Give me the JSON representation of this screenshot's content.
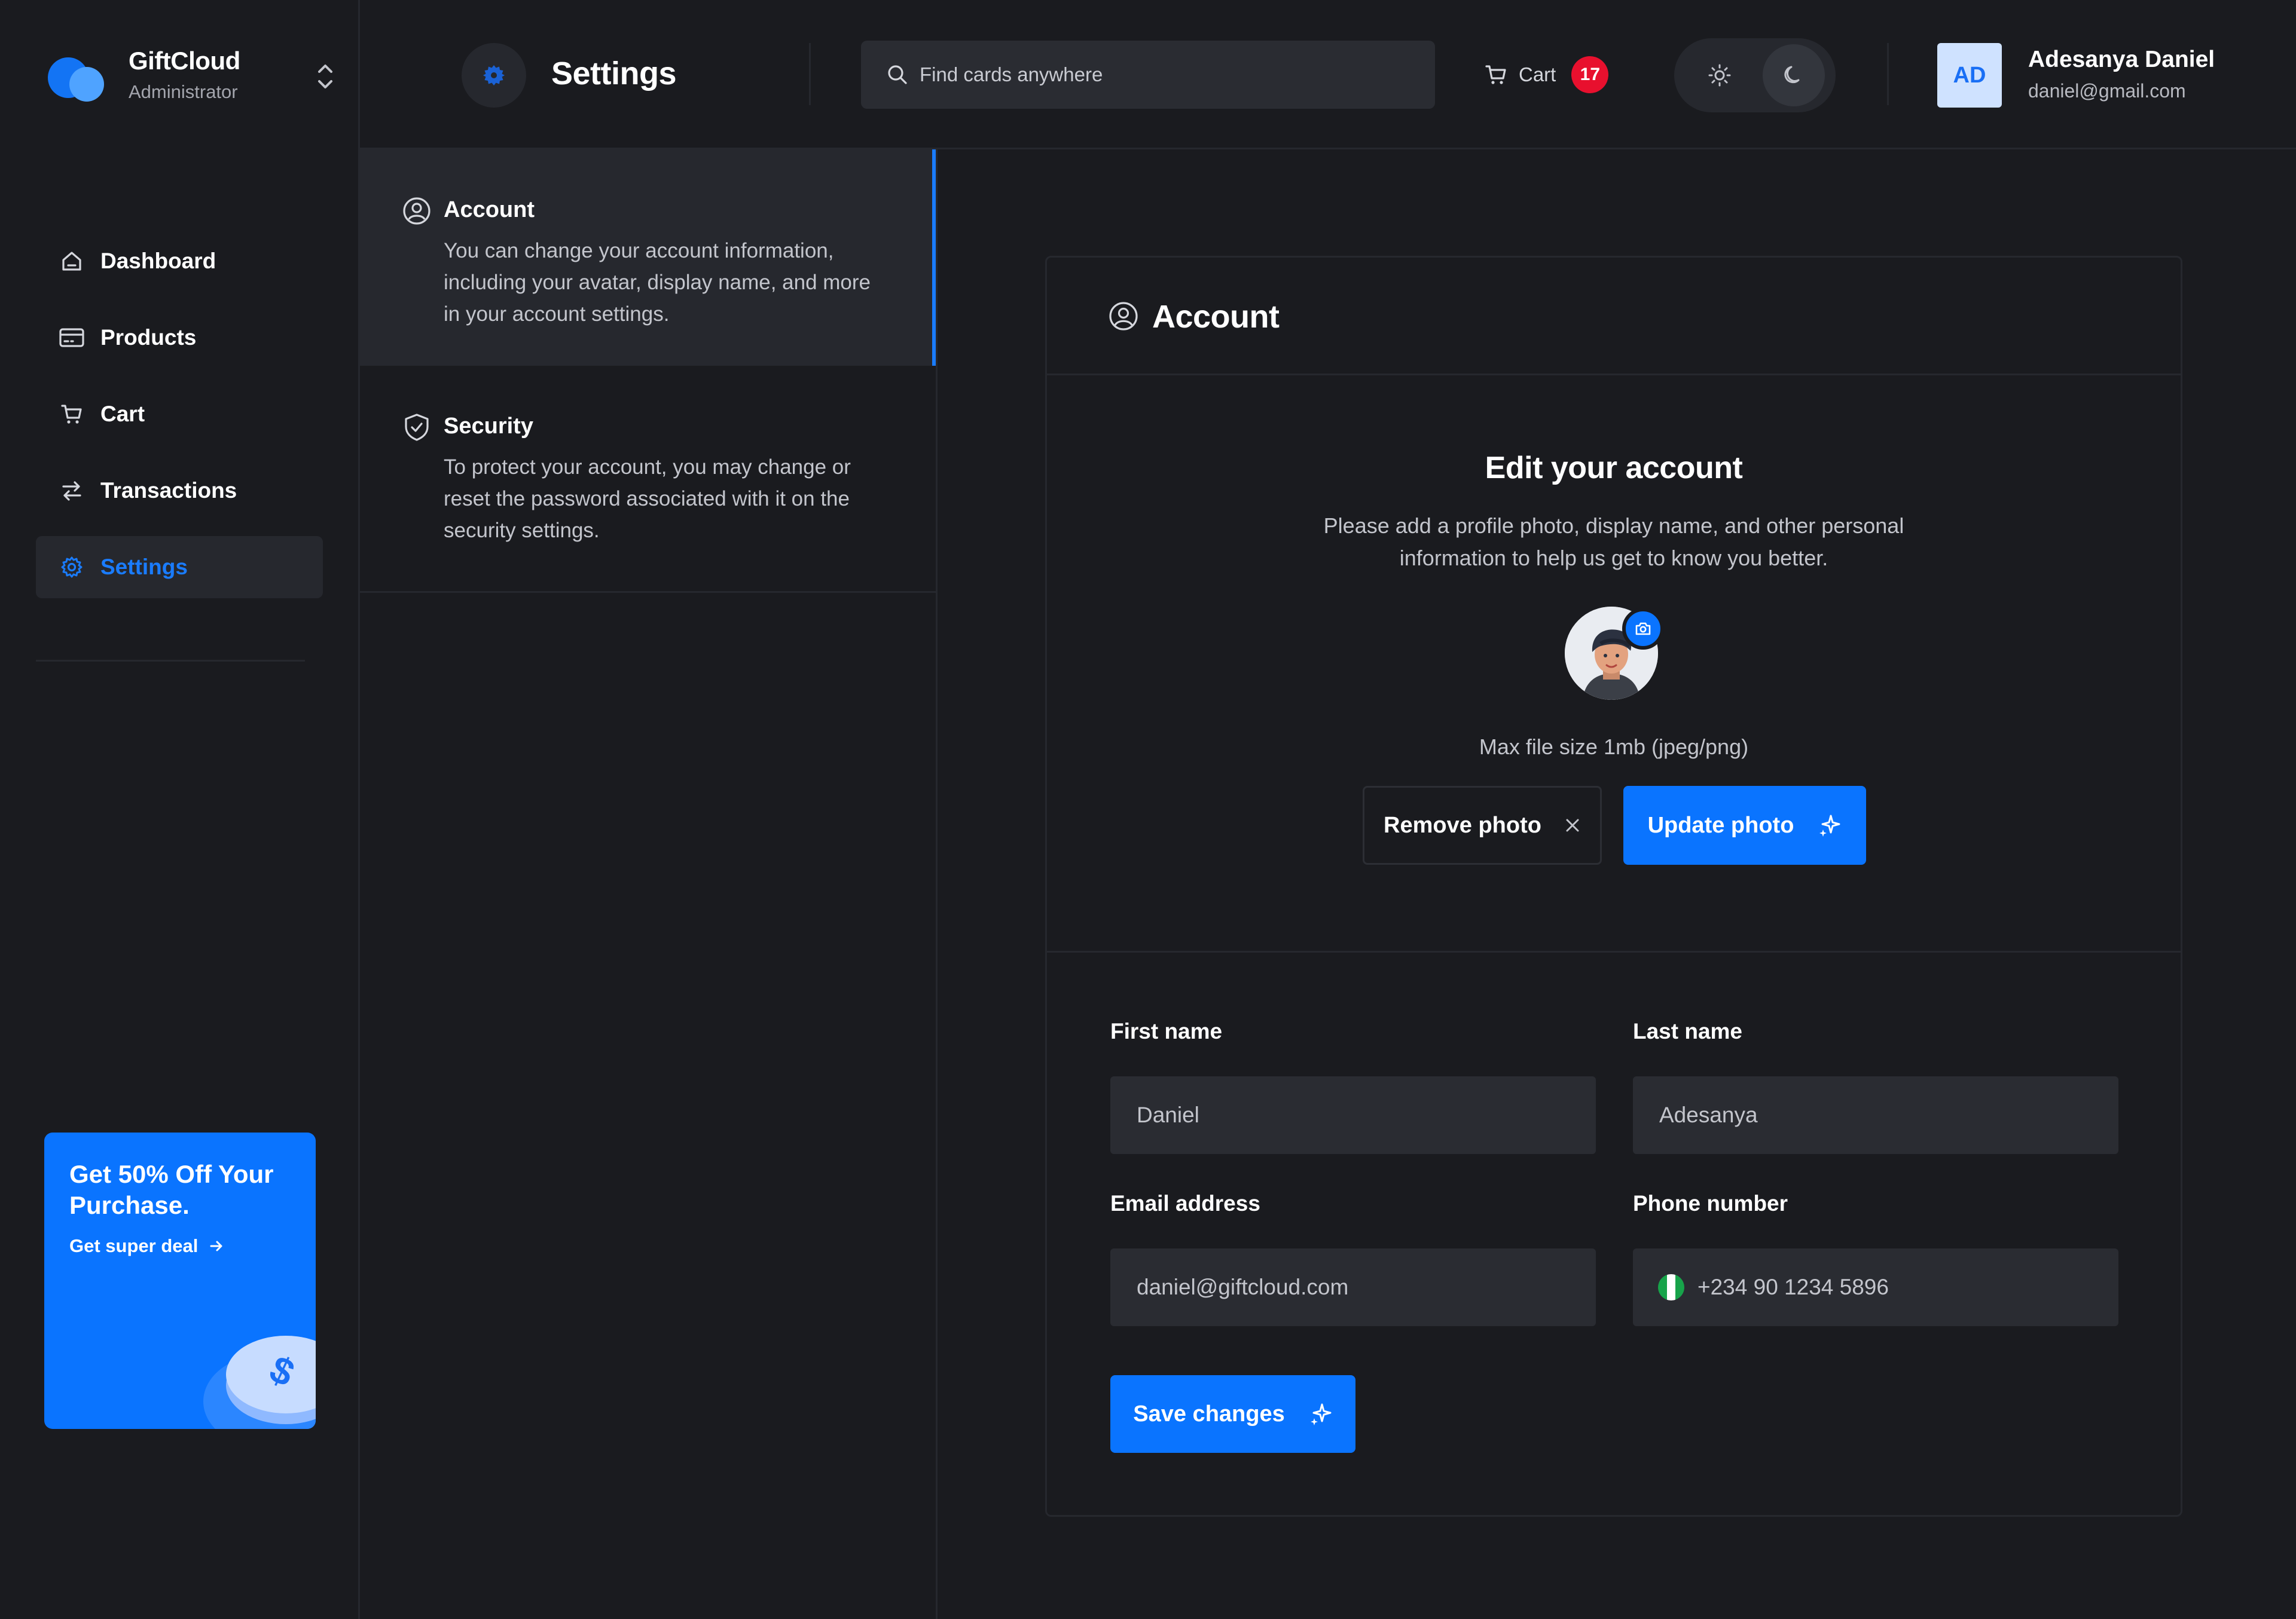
{
  "brand": {
    "name": "GiftCloud",
    "role": "Administrator",
    "colors": {
      "primary": "#1374f4",
      "secondary": "#4fa3ff"
    }
  },
  "sidebar": {
    "items": [
      {
        "label": "Dashboard",
        "icon": "home-icon"
      },
      {
        "label": "Products",
        "icon": "card-icon"
      },
      {
        "label": "Cart",
        "icon": "cart-icon"
      },
      {
        "label": "Transactions",
        "icon": "swap-arrows-icon"
      },
      {
        "label": "Settings",
        "icon": "gear-icon",
        "active": true
      }
    ]
  },
  "promo": {
    "title": "Get 50% Off Your Purchase.",
    "link": "Get super deal",
    "color": "#0a74ff"
  },
  "header": {
    "title": "Settings",
    "search_placeholder": "Find cards anywhere",
    "cart_label": "Cart",
    "cart_count": "17",
    "theme": "dark"
  },
  "user": {
    "initials": "AD",
    "name": "Adesanya Daniel",
    "email": "daniel@gmail.com"
  },
  "settings_menu": [
    {
      "title": "Account",
      "desc": "You can change your account information, including your avatar, display name, and more in your account settings.",
      "active": true
    },
    {
      "title": "Security",
      "desc": "To protect your account, you may change or reset the password associated with it on the security settings.",
      "active": false
    }
  ],
  "account": {
    "card_title": "Account",
    "edit_title": "Edit your account",
    "edit_sub": "Please add a profile photo, display name, and other personal information to help us get to know you better.",
    "file_hint": "Max file size 1mb (jpeg/png)",
    "remove_label": "Remove photo",
    "update_label": "Update photo",
    "first_name_label": "First name",
    "first_name": "Daniel",
    "last_name_label": "Last name",
    "last_name": "Adesanya",
    "email_label": "Email address",
    "email": "daniel@giftcloud.com",
    "phone_label": "Phone number",
    "phone": "+234 90 1234 5896",
    "save_label": "Save changes"
  },
  "accent_color": "#0a74ff",
  "badge_color": "#e8102e"
}
